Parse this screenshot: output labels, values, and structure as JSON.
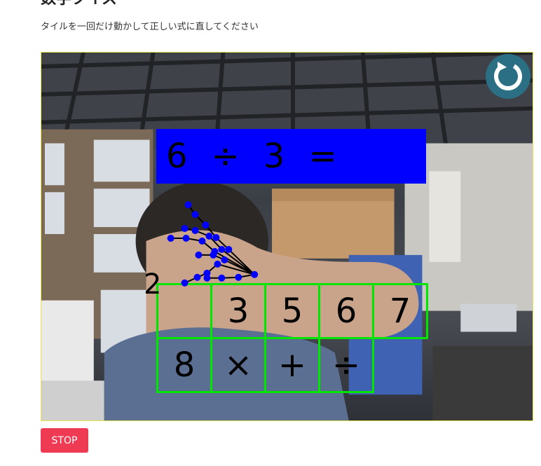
{
  "page": {
    "title": "数字クイズ",
    "instruction": "タイルを一回だけ動かして正しい式に直してください"
  },
  "quiz": {
    "equation": [
      "6",
      "÷",
      "3",
      "="
    ],
    "floating_tile": "2",
    "tiles_row1": [
      "",
      "3",
      "5",
      "6",
      "7"
    ],
    "tiles_row2": [
      "8",
      "×",
      "+",
      "÷",
      ""
    ]
  },
  "controls": {
    "reset_icon": "reload-icon",
    "stop_label": "STOP"
  },
  "colors": {
    "equation_bg": "#0000ff",
    "tile_border": "#00e600",
    "stop_button": "#ef3a54",
    "reset_button": "#2b6f84",
    "hand_landmarks": "#0000ff"
  }
}
